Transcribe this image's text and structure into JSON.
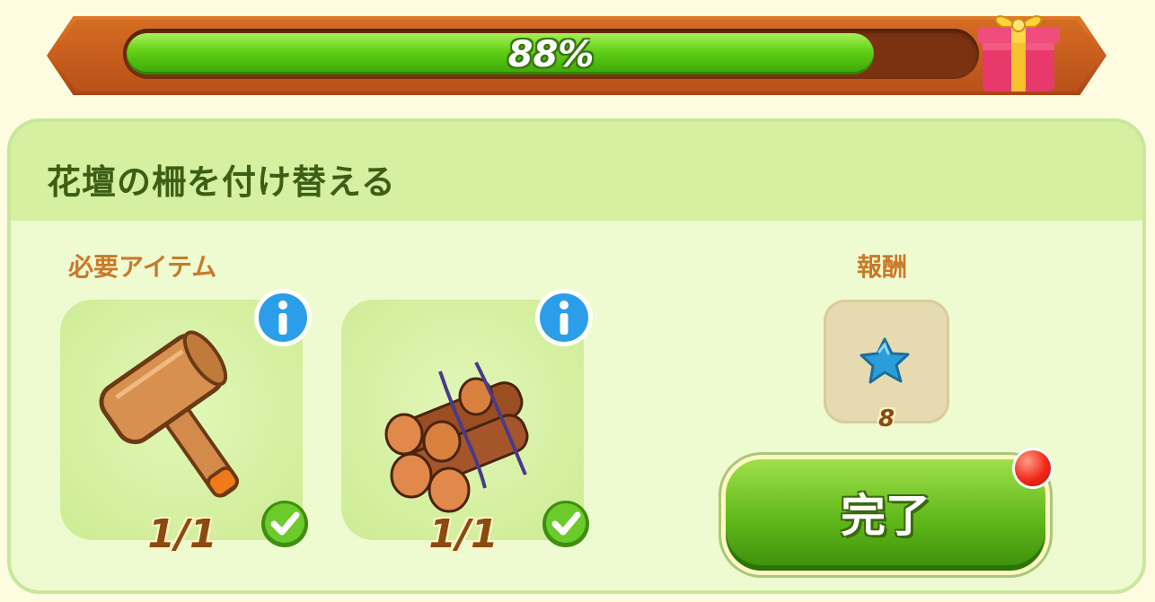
{
  "progress": {
    "percent": 88,
    "label": "88%"
  },
  "quest": {
    "title": "花壇の柵を付け替える",
    "required_label": "必要アイテム",
    "reward_label": "報酬",
    "items": [
      {
        "icon": "mallet-icon",
        "count": "1/1",
        "completed": true
      },
      {
        "icon": "logs-icon",
        "count": "1/1",
        "completed": true
      }
    ],
    "reward": {
      "icon": "blue-star-icon",
      "count": "8"
    },
    "complete_button": "完了"
  },
  "colors": {
    "progress_fill": "#5fcf14",
    "frame": "#c2571b",
    "card_bg": "#eefad0",
    "title_text": "#3d5e14",
    "label_text": "#c97a2a",
    "button": "#5fb81a",
    "notification": "#f22a18"
  }
}
